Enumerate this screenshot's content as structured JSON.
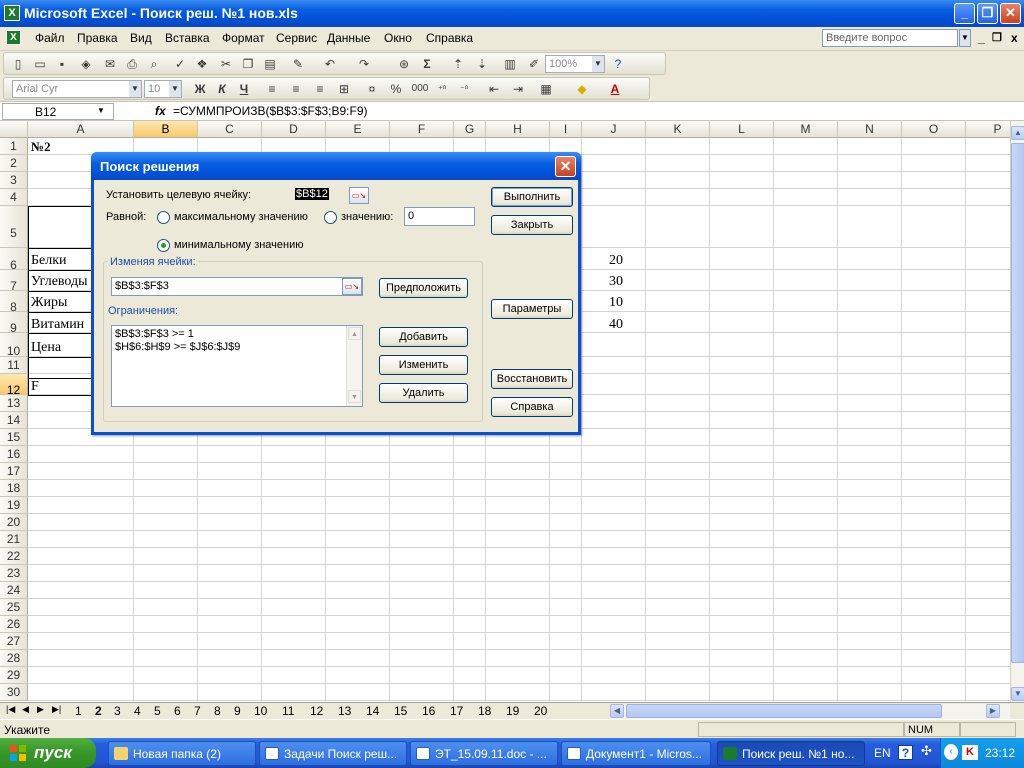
{
  "window": {
    "title": "Microsoft Excel - Поиск реш. №1 нов.xls",
    "minimize": "_",
    "restore": "❐",
    "close": "✕"
  },
  "menu": {
    "items": [
      "Файл",
      "Правка",
      "Вид",
      "Вставка",
      "Формат",
      "Сервис",
      "Данные",
      "Окно",
      "Справка"
    ],
    "help_placeholder": "Введите вопрос",
    "doc_min": "_",
    "doc_restore": "❐",
    "doc_close": "x"
  },
  "toolbar": {
    "zoom": "100%",
    "font": "Arial Cyr",
    "size": "10",
    "bold": "Ж",
    "italic": "К",
    "underline": "Ч",
    "percent": "%",
    "thousands": "000"
  },
  "formula_bar": {
    "name_box": "B12",
    "fx": "fx",
    "formula": "=СУММПРОИЗВ($B$3:$F$3;B9:F9)"
  },
  "grid": {
    "columns": [
      "A",
      "B",
      "C",
      "D",
      "E",
      "F",
      "G",
      "H",
      "I",
      "J",
      "K",
      "L",
      "M",
      "N",
      "O",
      "P"
    ],
    "selected_column": "B",
    "rows": [
      "1",
      "2",
      "3",
      "4",
      "5",
      "6",
      "7",
      "8",
      "9",
      "10",
      "11",
      "12",
      "13",
      "14",
      "15",
      "16",
      "17",
      "18",
      "19",
      "20",
      "21",
      "22",
      "23",
      "24",
      "25",
      "26",
      "27",
      "28",
      "29",
      "30"
    ],
    "selected_row": "12",
    "cells": {
      "a1": "№2",
      "a6": "Белки",
      "a7": "Углеводы",
      "a8": "Жиры",
      "a9": "Витамин",
      "a10": "Цена",
      "a12": "F",
      "j6": "20",
      "j7": "30",
      "j8": "10",
      "j9": "40"
    }
  },
  "sheet_tabs": {
    "tabs": [
      "1",
      "2",
      "3",
      "4",
      "5",
      "6",
      "7",
      "8",
      "9",
      "10",
      "11",
      "12",
      "13",
      "14",
      "15",
      "16",
      "17",
      "18",
      "19",
      "20"
    ],
    "active": "2"
  },
  "status": {
    "text": "Укажите",
    "num": "NUM"
  },
  "taskbar": {
    "start": "пуск",
    "tasks": [
      "Новая папка (2)",
      "Задачи Поиск реш...",
      "ЭТ_15.09.11.doc - ...",
      "Документ1 - Micros...",
      "Поиск реш. №1 но..."
    ],
    "lang": "EN",
    "clock": "23:12"
  },
  "dialog": {
    "title": "Поиск решения",
    "target_label": "Установить целевую ячейку:",
    "target_value": "$B$12",
    "equal_label": "Равной:",
    "opt_max": "максимальному значению",
    "opt_value": "значению:",
    "value_field": "0",
    "opt_min": "минимальному значению",
    "changing_label": "Изменяя ячейки:",
    "changing_value": "$B$3:$F$3",
    "guess_button": "Предположить",
    "constraints_label": "Ограничения:",
    "constraints": [
      "$B$3:$F$3 >= 1",
      "$H$6:$H$9 >= $J$6:$J$9"
    ],
    "add_button": "Добавить",
    "change_button": "Изменить",
    "delete_button": "Удалить",
    "solve_button": "Выполнить",
    "close_button": "Закрыть",
    "options_button": "Параметры",
    "reset_button": "Восстановить",
    "help_button": "Справка"
  }
}
